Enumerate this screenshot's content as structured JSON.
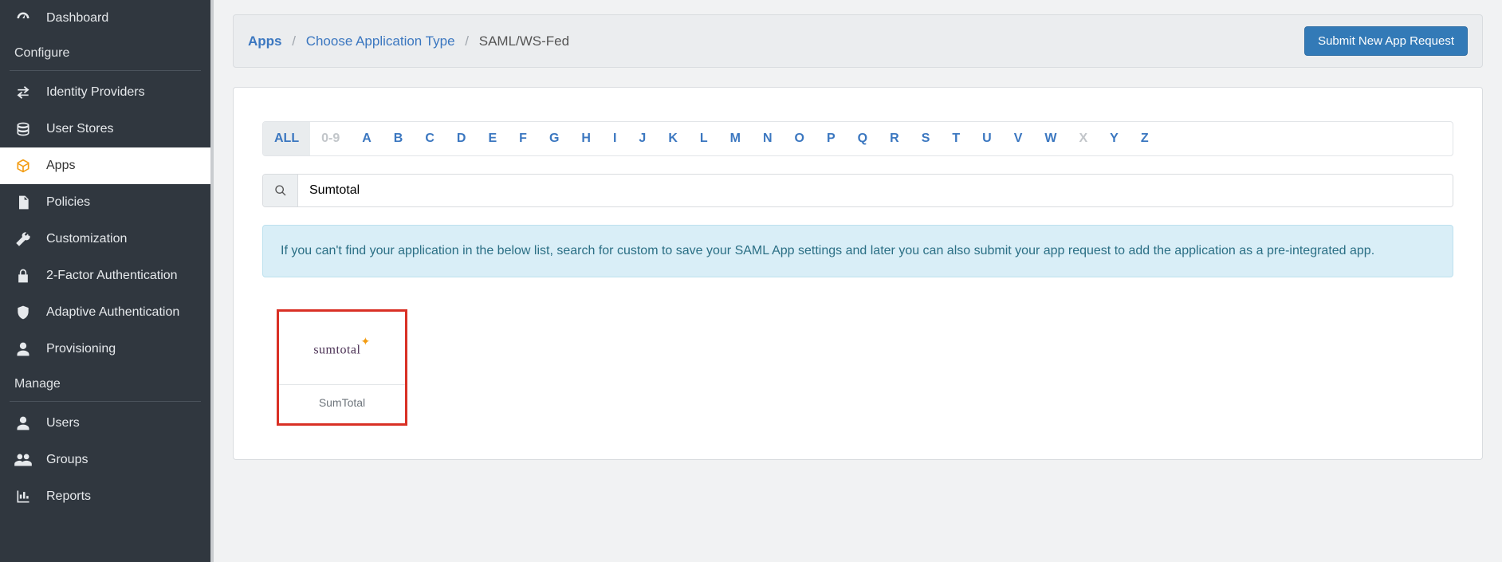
{
  "sidebar": {
    "dashboard": "Dashboard",
    "section_configure": "Configure",
    "identity_providers": "Identity Providers",
    "user_stores": "User Stores",
    "apps": "Apps",
    "policies": "Policies",
    "customization": "Customization",
    "two_factor": "2-Factor Authentication",
    "adaptive": "Adaptive Authentication",
    "provisioning": "Provisioning",
    "section_manage": "Manage",
    "users": "Users",
    "groups": "Groups",
    "reports": "Reports"
  },
  "breadcrumb": {
    "apps": "Apps",
    "choose_type": "Choose Application Type",
    "current": "SAML/WS-Fed"
  },
  "header": {
    "submit_button": "Submit New App Request"
  },
  "alpha": {
    "all": "ALL",
    "num": "0-9",
    "letters": [
      "A",
      "B",
      "C",
      "D",
      "E",
      "F",
      "G",
      "H",
      "I",
      "J",
      "K",
      "L",
      "M",
      "N",
      "O",
      "P",
      "Q",
      "R",
      "S",
      "T",
      "U",
      "V",
      "W",
      "X",
      "Y",
      "Z"
    ],
    "disabled": [
      "X"
    ]
  },
  "search": {
    "value": "Sumtotal"
  },
  "alert": "If you can't find your application in the below list, search for custom to save your SAML App settings and later you can also submit your app request to add the application as a pre-integrated app.",
  "results": [
    {
      "name": "SumTotal",
      "logo_text": "sumtotal"
    }
  ]
}
